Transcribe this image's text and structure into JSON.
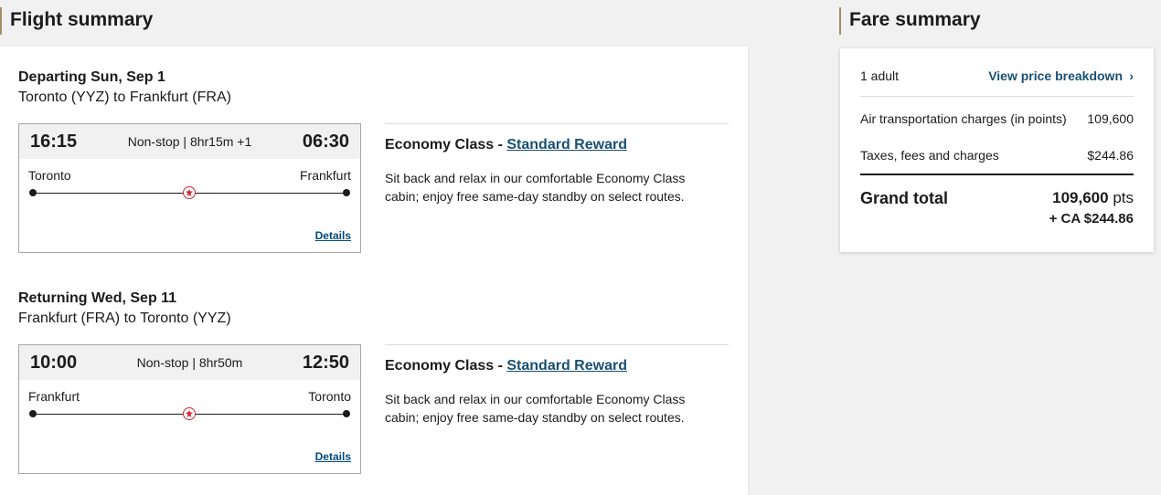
{
  "flight_summary": {
    "heading": "Flight summary",
    "bounds": [
      {
        "title": "Departing Sun, Sep 1",
        "route": "Toronto (YYZ) to Frankfurt (FRA)",
        "departure_time": "16:15",
        "arrival_time": "06:30",
        "duration": "Non-stop | 8hr15m +1",
        "origin_city": "Toronto",
        "destination_city": "Frankfurt",
        "details_label": "Details",
        "cabin_prefix": "Economy Class - ",
        "fare_type": "Standard Reward",
        "cabin_description": "Sit back and relax in our comfortable Economy Class cabin; enjoy free same-day standby on select routes."
      },
      {
        "title": "Returning Wed, Sep 11",
        "route": "Frankfurt (FRA) to Toronto (YYZ)",
        "departure_time": "10:00",
        "arrival_time": "12:50",
        "duration": "Non-stop | 8hr50m",
        "origin_city": "Frankfurt",
        "destination_city": "Toronto",
        "details_label": "Details",
        "cabin_prefix": "Economy Class - ",
        "fare_type": "Standard Reward",
        "cabin_description": "Sit back and relax in our comfortable Economy Class cabin; enjoy free same-day standby on select routes."
      }
    ]
  },
  "fare_summary": {
    "heading": "Fare summary",
    "passengers": "1 adult",
    "price_breakdown_label": "View price breakdown",
    "chevron": "›",
    "air_label": "Air transportation charges (in points)",
    "air_value": "109,600",
    "taxes_label": "Taxes, fees and charges",
    "taxes_value": "$244.86",
    "grand_total_label": "Grand total",
    "grand_total_points": "109,600",
    "grand_total_points_unit": " pts",
    "grand_total_cash": "+ CA $244.86"
  },
  "icons": {
    "route_logo": "maple-leaf-icon",
    "chevron": "chevron-right-icon"
  },
  "colors": {
    "link_blue": "#1a4f73",
    "brand_red": "#d22630",
    "heading_accent": "#a58d6a"
  }
}
